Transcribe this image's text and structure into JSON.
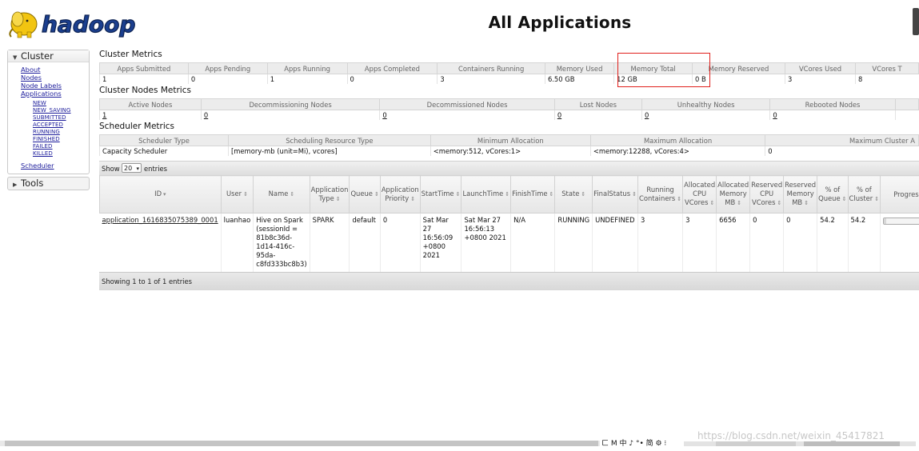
{
  "logo": {
    "text": "hadoop"
  },
  "page": {
    "title": "All Applications"
  },
  "sidebar": {
    "cluster_heading": "Cluster",
    "cluster_links": [
      "About",
      "Nodes",
      "Node Labels",
      "Applications"
    ],
    "app_states": [
      "NEW",
      "NEW_SAVING",
      "SUBMITTED",
      "ACCEPTED",
      "RUNNING",
      "FINISHED",
      "FAILED",
      "KILLED"
    ],
    "scheduler_link": "Scheduler",
    "tools_heading": "Tools"
  },
  "cluster_metrics": {
    "title": "Cluster Metrics",
    "headers": [
      "Apps Submitted",
      "Apps Pending",
      "Apps Running",
      "Apps Completed",
      "Containers Running",
      "Memory Used",
      "Memory Total",
      "Memory Reserved",
      "VCores Used",
      "VCores T"
    ],
    "values": [
      "1",
      "0",
      "1",
      "0",
      "3",
      "6.50 GB",
      "12 GB",
      "0 B",
      "3",
      "8"
    ]
  },
  "cluster_nodes_metrics": {
    "title": "Cluster Nodes Metrics",
    "headers": [
      "Active Nodes",
      "Decommissioning Nodes",
      "Decommissioned Nodes",
      "Lost Nodes",
      "Unhealthy Nodes",
      "Rebooted Nodes"
    ],
    "values": [
      "1",
      "0",
      "0",
      "0",
      "0",
      "0"
    ]
  },
  "scheduler_metrics": {
    "title": "Scheduler Metrics",
    "headers": [
      "Scheduler Type",
      "Scheduling Resource Type",
      "Minimum Allocation",
      "Maximum Allocation",
      "Maximum Cluster A"
    ],
    "values": [
      "Capacity Scheduler",
      "[memory-mb (unit=Mi), vcores]",
      "<memory:512, vCores:1>",
      "<memory:12288, vCores:4>",
      "0"
    ]
  },
  "apps": {
    "show_label": "Show",
    "page_size": "20",
    "entries_label": "entries",
    "headers": [
      "ID",
      "User",
      "Name",
      "Application Type",
      "Queue",
      "Application Priority",
      "StartTime",
      "LaunchTime",
      "FinishTime",
      "State",
      "FinalStatus",
      "Running Containers",
      "Allocated CPU VCores",
      "Allocated Memory MB",
      "Reserved CPU VCores",
      "Reserved Memory MB",
      "% of Queue",
      "% of Cluster",
      "Progress"
    ],
    "rows": [
      [
        "application_1616835075389_0001",
        "luanhao",
        "Hive on Spark (sessionId = 81b8c36d-1d14-416c-95da-c8fd333bc8b3)",
        "SPARK",
        "default",
        "0",
        "Sat Mar 27 16:56:09 +0800 2021",
        "Sat Mar 27 16:56:13 +0800 2021",
        "N/A",
        "RUNNING",
        "UNDEFINED",
        "3",
        "3",
        "6656",
        "0",
        "0",
        "54.2",
        "54.2",
        ""
      ]
    ],
    "progress": [
      0.05
    ],
    "footer": "Showing 1 to 1 of 1 entries"
  },
  "ime": {
    "text": "ㄈ M 中 ♪ °• 简 ⚙ ⁝"
  },
  "watermark": "https://blog.csdn.net/weixin_45417821",
  "colors": {
    "highlight": "#e0201c",
    "link": "#1a1a9a",
    "logo_yellow": "#f2c511",
    "logo_blue": "#1b3f8f"
  }
}
